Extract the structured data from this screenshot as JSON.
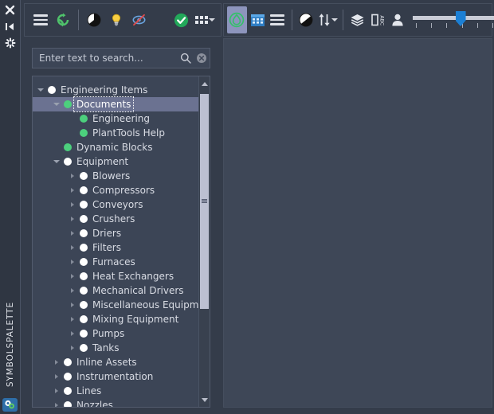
{
  "dock": {
    "buttons": [
      {
        "name": "close-icon",
        "label": "Close"
      },
      {
        "name": "auto-hide-icon",
        "label": "Auto Hide"
      },
      {
        "name": "panel-options-icon",
        "label": "Options"
      }
    ],
    "title": "SYMBOLSPALETTE",
    "app_icon_label": "PlantTools"
  },
  "toolbar_left": {
    "items": [
      {
        "name": "menu-icon",
        "label": "Menu"
      },
      {
        "name": "refresh-icon",
        "label": "Refresh"
      },
      {
        "name": "contrast-icon",
        "label": "Contrast"
      },
      {
        "name": "lightbulb-icon",
        "label": "Highlight"
      },
      {
        "name": "hide-preview-icon",
        "label": "Hide Preview"
      },
      {
        "name": "apply-check-icon",
        "label": "Apply"
      },
      {
        "name": "grid-options-icon",
        "label": "Grid Options"
      }
    ]
  },
  "toolbar_right": {
    "items": [
      {
        "name": "symbol-view-icon",
        "label": "Symbol View",
        "active": true
      },
      {
        "name": "grid-view-icon",
        "label": "Grid View",
        "active": false
      },
      {
        "name": "list-view-icon",
        "label": "List View",
        "active": false
      },
      {
        "name": "contrast-icon",
        "label": "Contrast",
        "active": false
      },
      {
        "name": "sort-icon",
        "label": "Sort",
        "active": false
      },
      {
        "name": "layers-icon",
        "label": "Layers",
        "active": false
      },
      {
        "name": "label-abc-icon",
        "label": "Labels",
        "active": false
      },
      {
        "name": "user-icon",
        "label": "User",
        "active": false
      }
    ],
    "slider": {
      "name": "zoom-slider",
      "value": 4,
      "min": 1,
      "max": 6,
      "ticks": 6
    }
  },
  "search": {
    "placeholder": "Enter text to search...",
    "value": "",
    "search_icon": "search-icon",
    "clear_icon": "clear-icon"
  },
  "tree": {
    "items": [
      {
        "label": "Engineering Items",
        "depth": 0,
        "chevron": "down",
        "dot": "white",
        "selected": false
      },
      {
        "label": "Documents",
        "depth": 1,
        "chevron": "down",
        "dot": "green",
        "selected": true
      },
      {
        "label": "Engineering",
        "depth": 2,
        "chevron": "none",
        "dot": "green",
        "selected": false
      },
      {
        "label": "PlantTools Help",
        "depth": 2,
        "chevron": "none",
        "dot": "green",
        "selected": false
      },
      {
        "label": "Dynamic Blocks",
        "depth": 1,
        "chevron": "none",
        "dot": "green",
        "selected": false
      },
      {
        "label": "Equipment",
        "depth": 1,
        "chevron": "down",
        "dot": "white",
        "selected": false
      },
      {
        "label": "Blowers",
        "depth": 2,
        "chevron": "right",
        "dot": "white",
        "selected": false
      },
      {
        "label": "Compressors",
        "depth": 2,
        "chevron": "right",
        "dot": "white",
        "selected": false
      },
      {
        "label": "Conveyors",
        "depth": 2,
        "chevron": "right",
        "dot": "white",
        "selected": false
      },
      {
        "label": "Crushers",
        "depth": 2,
        "chevron": "right",
        "dot": "white",
        "selected": false
      },
      {
        "label": "Driers",
        "depth": 2,
        "chevron": "right",
        "dot": "white",
        "selected": false
      },
      {
        "label": "Filters",
        "depth": 2,
        "chevron": "right",
        "dot": "white",
        "selected": false
      },
      {
        "label": "Furnaces",
        "depth": 2,
        "chevron": "right",
        "dot": "white",
        "selected": false
      },
      {
        "label": "Heat Exchangers",
        "depth": 2,
        "chevron": "right",
        "dot": "white",
        "selected": false
      },
      {
        "label": "Mechanical Drivers",
        "depth": 2,
        "chevron": "right",
        "dot": "white",
        "selected": false
      },
      {
        "label": "Miscellaneous Equipment",
        "depth": 2,
        "chevron": "right",
        "dot": "white",
        "selected": false
      },
      {
        "label": "Mixing Equipment",
        "depth": 2,
        "chevron": "right",
        "dot": "white",
        "selected": false
      },
      {
        "label": "Pumps",
        "depth": 2,
        "chevron": "right",
        "dot": "white",
        "selected": false
      },
      {
        "label": "Tanks",
        "depth": 2,
        "chevron": "right",
        "dot": "white",
        "selected": false
      },
      {
        "label": "Inline Assets",
        "depth": 1,
        "chevron": "right",
        "dot": "white",
        "selected": false
      },
      {
        "label": "Instrumentation",
        "depth": 1,
        "chevron": "right",
        "dot": "white",
        "selected": false
      },
      {
        "label": "Lines",
        "depth": 1,
        "chevron": "right",
        "dot": "white",
        "selected": false
      },
      {
        "label": "Nozzles",
        "depth": 1,
        "chevron": "right",
        "dot": "white",
        "selected": false
      }
    ],
    "scrollbar": {
      "name": "tree-scrollbar"
    }
  },
  "colors": {
    "panel_bg": "#343c4a",
    "field_bg": "#3c4556",
    "canvas_bg": "#3e4757",
    "selection": "#6b7291",
    "green": "#4cd07d",
    "accent_blue": "#1b7fd4",
    "text": "#d9dce4"
  }
}
